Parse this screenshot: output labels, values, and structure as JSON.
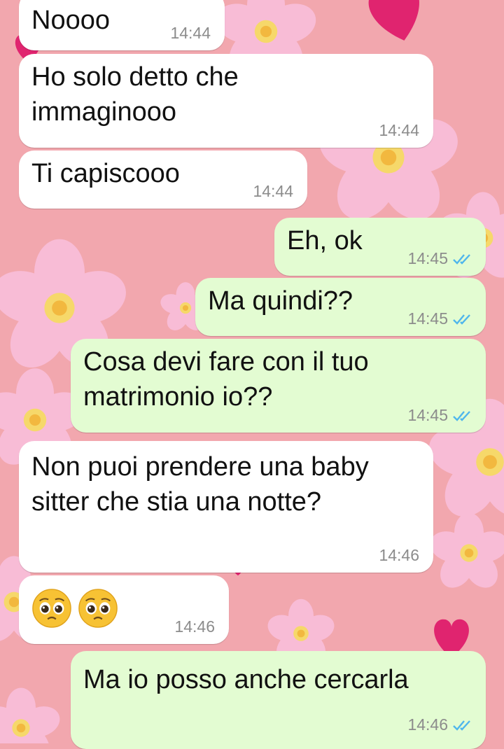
{
  "chat": {
    "accent_incoming": "#ffffff",
    "accent_outgoing": "#e3fcd2",
    "tick_color": "#4fb6ec",
    "wallpaper": "pink-cherry-blossom-and-hearts",
    "messages": [
      {
        "id": "m1",
        "direction": "incoming",
        "text": "Noooo",
        "time": "14:44"
      },
      {
        "id": "m2",
        "direction": "incoming",
        "text": "Ho solo detto che immaginooo",
        "time": "14:44"
      },
      {
        "id": "m3",
        "direction": "incoming",
        "text": "Ti capiscooo",
        "time": "14:44"
      },
      {
        "id": "m4",
        "direction": "outgoing",
        "text": "Eh, ok",
        "time": "14:45",
        "status": "read-double-check-icon"
      },
      {
        "id": "m5",
        "direction": "outgoing",
        "text": "Ma quindi??",
        "time": "14:45",
        "status": "read-double-check-icon"
      },
      {
        "id": "m6",
        "direction": "outgoing",
        "text": "Cosa devi fare con il tuo matrimonio io??",
        "time": "14:45",
        "status": "read-double-check-icon"
      },
      {
        "id": "m7",
        "direction": "incoming",
        "text": "Non puoi prendere una baby sitter che stia una notte?",
        "time": "14:46"
      },
      {
        "id": "m8",
        "direction": "incoming",
        "emoji": [
          "pleading-face-icon",
          "pleading-face-icon"
        ],
        "time": "14:46"
      },
      {
        "id": "m9",
        "direction": "outgoing",
        "text": "Ma io posso anche cercarla",
        "time": "14:46",
        "status": "read-double-check-icon"
      }
    ]
  }
}
